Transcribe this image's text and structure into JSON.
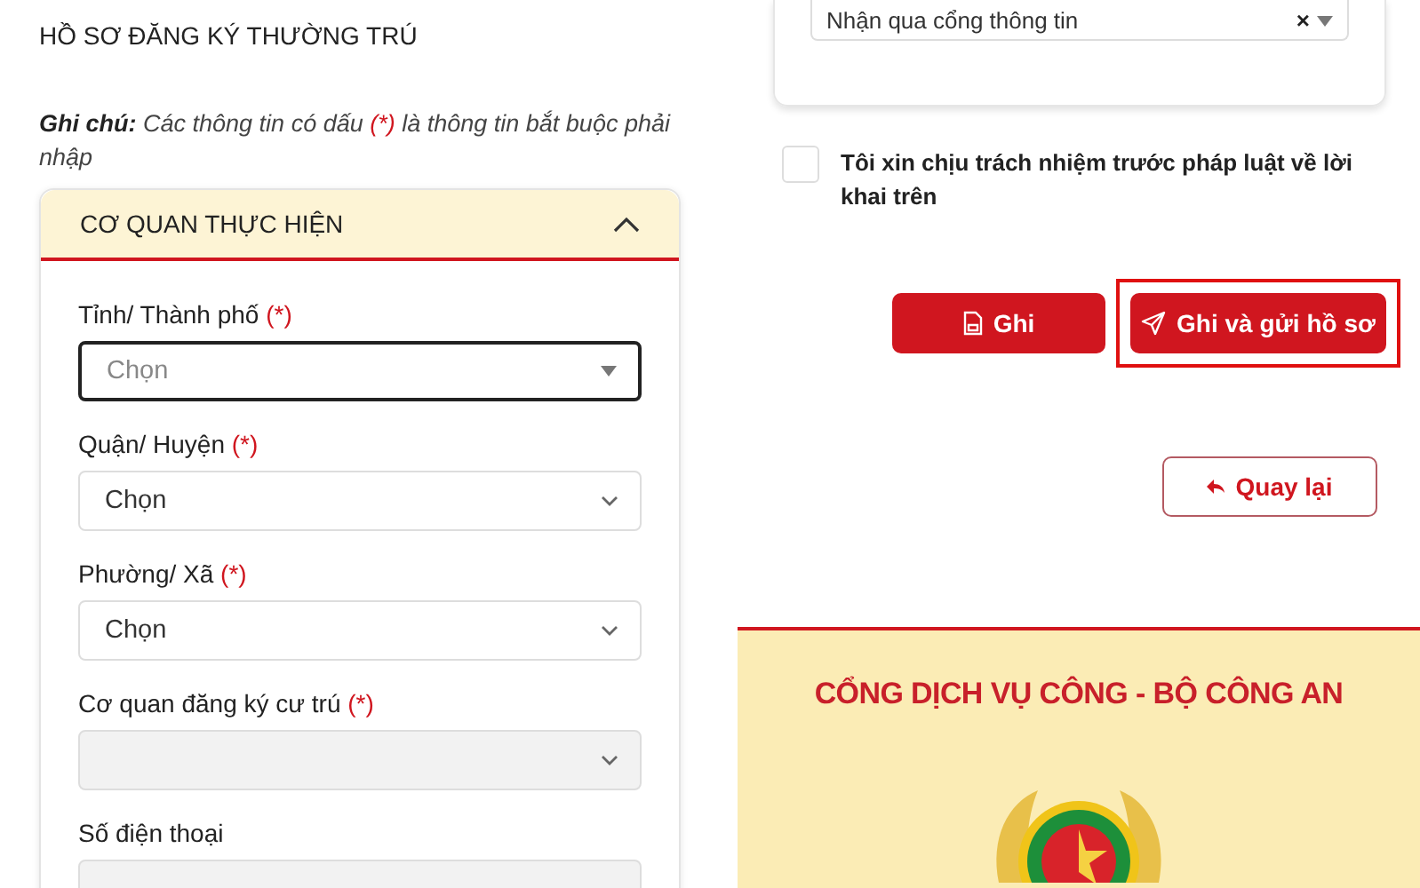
{
  "title": "HỒ SƠ ĐĂNG KÝ THƯỜNG TRÚ",
  "note": {
    "label": "Ghi chú:",
    "text_before": "Các thông tin có dấu ",
    "mark": "(*)",
    "text_after": " là thông tin bắt buộc phải nhập"
  },
  "section": {
    "title": "CƠ QUAN THỰC HIỆN",
    "expanded": true,
    "fields": [
      {
        "label": "Tỉnh/ Thành phố",
        "required_mark": "(*)",
        "kind": "select",
        "placeholder": "Chọn",
        "focused": true,
        "disabled": false
      },
      {
        "label": "Quận/ Huyện",
        "required_mark": "(*)",
        "kind": "select",
        "value": "Chọn",
        "focused": false,
        "disabled": false
      },
      {
        "label": "Phường/ Xã",
        "required_mark": "(*)",
        "kind": "select",
        "value": "Chọn",
        "focused": false,
        "disabled": false
      },
      {
        "label": "Cơ quan đăng ký cư trú",
        "required_mark": "(*)",
        "kind": "select",
        "focused": false,
        "disabled": true
      },
      {
        "label": "Số điện thoại",
        "kind": "text",
        "focused": false,
        "disabled": true
      }
    ]
  },
  "delivery_select": {
    "value": "Nhận qua cổng thông tin",
    "clear": "×"
  },
  "agreement": {
    "checked": false,
    "text": "Tôi xin chịu trách nhiệm trước pháp luật về lời khai trên"
  },
  "actions": [
    {
      "label": "Ghi",
      "kind": "save",
      "highlighted": false
    },
    {
      "label": "Ghi và gửi hồ sơ",
      "kind": "send",
      "highlighted": true
    }
  ],
  "back_button": {
    "label": "Quay lại"
  },
  "banner": {
    "title": "CỔNG DỊCH VỤ CÔNG - BỘ CÔNG AN"
  }
}
